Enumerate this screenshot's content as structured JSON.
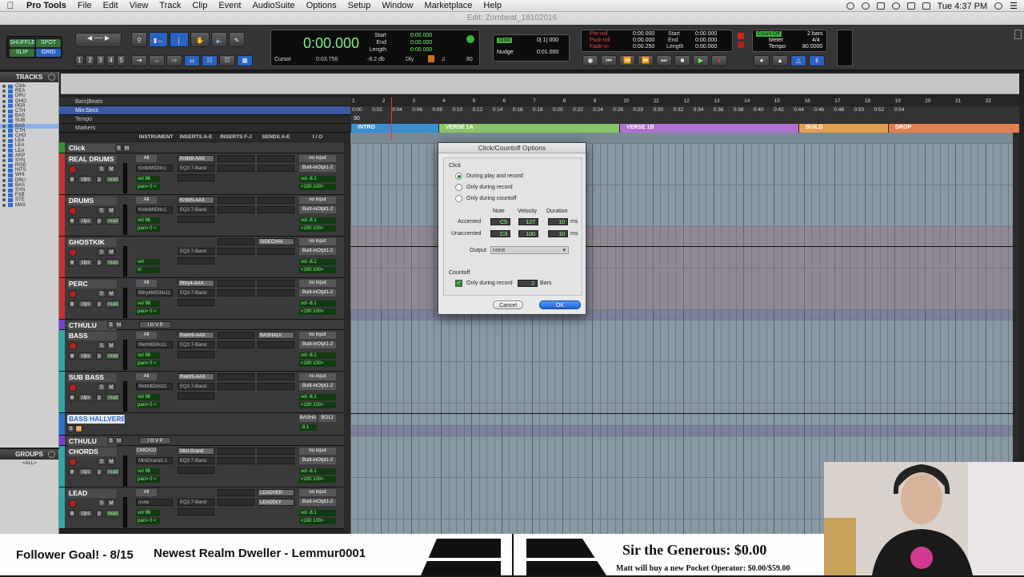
{
  "menubar": {
    "app": "Pro Tools",
    "items": [
      "File",
      "Edit",
      "View",
      "Track",
      "Clip",
      "Event",
      "AudioSuite",
      "Options",
      "Setup",
      "Window",
      "Marketplace",
      "Help"
    ],
    "clock": "Tue 4:37 PM"
  },
  "window_title": "Edit: Zombeat_18102016",
  "toolbar": {
    "edit_modes": [
      "SHUFFLE",
      "SPOT",
      "SLIP",
      "GRID"
    ],
    "main_counter": "0:00.000",
    "start_label": "Start",
    "end_label": "End",
    "length_label": "Length",
    "start_val": "0:00.000",
    "end_val": "0:00.000",
    "length_val": "0:00.000",
    "cursor_label": "Cursor",
    "cursor_val": "0:03.756",
    "cursor_db": "-8.2 db",
    "dly": "Dly",
    "tempo_small": "80",
    "grid_label": "Grid",
    "grid_val": "0| 1| 000",
    "nudge_label": "Nudge",
    "nudge_val": "0:01.000",
    "preroll_label": "Pre-roll",
    "postroll_label": "Post-roll",
    "fadein_label": "Fade-in",
    "preroll_val": "0:00.000",
    "postroll_val": "0:00.000",
    "fadein_val": "0:00.250",
    "t_start_val": "0:00.000",
    "t_end_val": "0:00.000",
    "t_length_val": "0:00.000",
    "countoff_label": "Count Off",
    "countoff_val": "2 bars",
    "meter_label": "Meter",
    "meter_val": "4/4",
    "tempo_label": "Tempo",
    "tempo_val": "80.0000",
    "zoom_numbers": [
      "1",
      "2",
      "3",
      "4",
      "5"
    ]
  },
  "tracks_panel": {
    "title": "TRACKS",
    "items": [
      "Click",
      "REA",
      "DRU",
      "GHO",
      "PER",
      "CTH",
      "BAS",
      "SUB",
      "BAS",
      "CTH",
      "CHO",
      "LEA",
      "LEA",
      "LEA",
      "ARP",
      "SYN",
      "RISE",
      "HITS",
      "WHI",
      "DRU",
      "BAS",
      "SYN",
      "FXB",
      "STE",
      "MAS"
    ]
  },
  "groups_panel": {
    "title": "GROUPS",
    "item": "<ALL>"
  },
  "rulers": {
    "bars_beats": "Bars|Beats",
    "min_secs": "Min:Secs",
    "tempo": "Tempo",
    "markers": "Markers",
    "tempo_marker": "90",
    "bar_numbers": [
      "1",
      "2",
      "3",
      "4",
      "5",
      "6",
      "7",
      "8",
      "9",
      "10",
      "11",
      "12",
      "13",
      "14",
      "15",
      "16",
      "17",
      "18",
      "19",
      "20",
      "21",
      "22"
    ],
    "seconds": [
      "0:00",
      "0:02",
      "0:04",
      "0:06",
      "0:08",
      "0:10",
      "0:12",
      "0:14",
      "0:16",
      "0:18",
      "0:20",
      "0:22",
      "0:24",
      "0:26",
      "0:28",
      "0:30",
      "0:32",
      "0:34",
      "0:36",
      "0:38",
      "0:40",
      "0:42",
      "0:44",
      "0:46",
      "0:48",
      "0:50",
      "0:52",
      "0:54"
    ],
    "markers_list": [
      "INTRO",
      "VERSE 1A",
      "VERSE 1B",
      "BUILD",
      "DROP"
    ]
  },
  "column_headers": [
    "INSTRUMENT",
    "INSERTS A-E",
    "INSERTS F-J",
    "SENDS A-E",
    "I / O"
  ],
  "tracks": [
    {
      "name": "Click",
      "color": "#3b8f3b",
      "kind": "click"
    },
    {
      "name": "REAL DRUMS",
      "color": "#c83232",
      "inst": "All",
      "ins1": "Kntkt8-AAX",
      "ins2": "EQ3 7-Band",
      "midi": "KntktMIDIIn1",
      "io_in": "no input",
      "io_out": "Built-inOtpt1-2",
      "vol": "vol 96",
      "pan": "pan> 0 <",
      "vol2": "vol -8.1",
      "pan2": "<100 100>"
    },
    {
      "name": "DRUMS",
      "color": "#c83232",
      "inst": "All",
      "ins1": "Kntkt5-AAX",
      "ins2": "EQ3 7-Band",
      "midi": "KntktMIDIIn1",
      "io_in": "no input",
      "io_out": "Built-inOtpt1-2",
      "vol": "vol 96",
      "pan": "pan> 0 <",
      "vol2": "vol -8.1",
      "pan2": "<100 100>"
    },
    {
      "name": "GHOSTKIK",
      "color": "#c83232",
      "inst": "",
      "ins1": "",
      "ins2": "EQ3 7-Band",
      "midi": "",
      "send": "SIDECHAI",
      "io_in": "no input",
      "io_out": "Built-inOtpt1-2",
      "vol": "vol",
      "pan": "nl",
      "vol2": "vol -8.1",
      "pan2": "<100 100>"
    },
    {
      "name": "PERC",
      "color": "#c83232",
      "inst": "All",
      "ins1": "Bttry4-AAX",
      "ins2": "EQ3 7-Band",
      "midi": "Bttry4MIDIIn21",
      "io_in": "no input",
      "io_out": "Built-inOtpt1-2",
      "vol": "vol 96",
      "pan": "pan> 0 <",
      "vol2": "vol -8.1",
      "pan2": "<100 100>"
    },
    {
      "name": "CTHULU",
      "color": "#7a3fd0",
      "kind": "folder"
    },
    {
      "name": "BASS",
      "color": "#2fa8a8",
      "inst": "All",
      "ins1": "Rektr6-AAX",
      "ins2": "EQ3 7-Band",
      "midi": "RktrMIDIIn11",
      "send": "BASHALV",
      "io_in": "no input",
      "io_out": "Built-inOtpt1-2",
      "vol": "vol 96",
      "pan": "pan> 0 <",
      "vol2": "vol -8.1",
      "pan2": "<100 100>"
    },
    {
      "name": "SUB BASS",
      "color": "#2fa8a8",
      "inst": "All",
      "ins1": "Rektr5-AAX",
      "ins2": "EQ3 7-Band",
      "midi": "RktrMIDIIn21",
      "io_in": "no input",
      "io_out": "Built-inOtpt1-2",
      "vol": "vol 96",
      "pan": "pan> 0 <",
      "vol2": "vol -8.1",
      "pan2": "<100 100>"
    },
    {
      "name": "BASS HALLVERB",
      "color": "#2f6fd0",
      "kind": "aux",
      "io_in": "BASHA",
      "io_out": "BO12",
      "vol2": "-8.1"
    },
    {
      "name": "CTHULU",
      "color": "#7a3fd0",
      "kind": "folder"
    },
    {
      "name": "CHORDS",
      "color": "#2fa8a8",
      "inst": "CMIDIO2",
      "ins1": "Mini Grand",
      "ins2": "EQ3 7-Band",
      "midi": "MiniGrand1-1",
      "io_in": "no input",
      "io_out": "Built-inOtpt1-2",
      "vol": "vol 96",
      "pan": "pan> 0 <",
      "vol2": "vol -8.1",
      "pan2": "<100 100>"
    },
    {
      "name": "LEAD",
      "color": "#2fa8a8",
      "inst": "All",
      "ins1": "",
      "ins2": "EQ3 7-Band",
      "midi": "none",
      "send": "LEADVER",
      "send2": "LEADDLY",
      "io_in": "no input",
      "io_out": "Built-inOtpt1-2",
      "vol": "vol 96",
      "pan": "pan> 0 <",
      "vol2": "vol -8.1",
      "pan2": "<100 100>"
    }
  ],
  "dialog": {
    "title": "Click/Countoff Options",
    "click_section": "Click",
    "radio_options": [
      "During play and record",
      "Only during record",
      "Only during countoff"
    ],
    "col_note": "Note",
    "col_velocity": "Velocity",
    "col_duration": "Duration",
    "accented_label": "Accented",
    "accented_note": "C5",
    "accented_velocity": "127",
    "accented_duration": "10",
    "accented_unit": "ms",
    "unaccented_label": "Unaccented",
    "unaccented_note": "C3",
    "unaccented_velocity": "100",
    "unaccented_duration": "10",
    "unaccented_unit": "ms",
    "output_label": "Output",
    "output_val": "none",
    "countoff_section": "Countoff",
    "countoff_checkbox": "Only during record",
    "countoff_bars": "2",
    "bars_label": "Bars",
    "cancel": "Cancel",
    "ok": "OK"
  },
  "stream": {
    "follower_goal": "Follower Goal! - 8/15",
    "newest": "Newest Realm Dweller - Lemmur0001",
    "generous": "Sir  the Generous: $0.00",
    "pocket": "Matt will buy a new Pocket Operator: $0.00/$59.00"
  },
  "colors": {
    "accent_green": "#7ef07e",
    "record_red": "#b82020",
    "folder_purple": "#7a3fd0",
    "teal": "#2fa8a8"
  }
}
